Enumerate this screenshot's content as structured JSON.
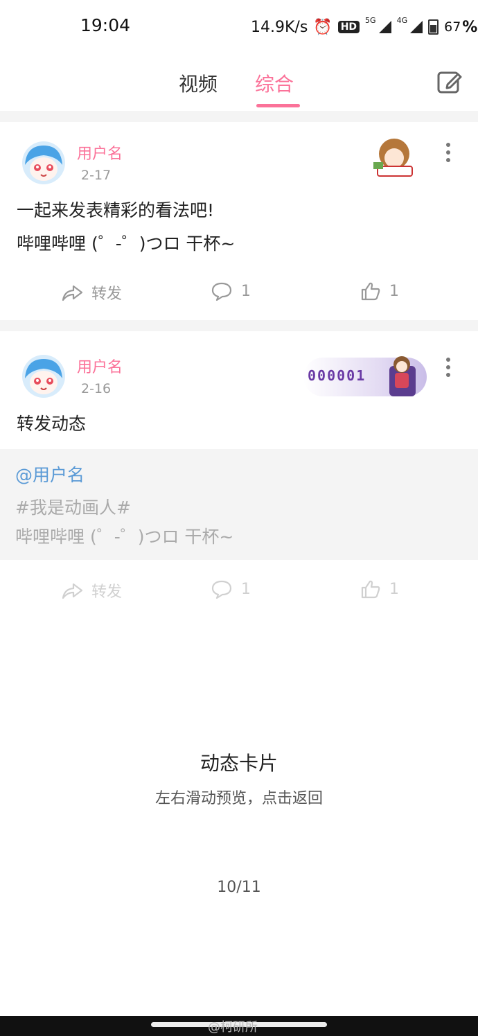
{
  "status_bar": {
    "time": "19:04",
    "net_speed": "14.9K/s",
    "hd_badge": "HD",
    "net_5g": "5G",
    "net_4g": "4G",
    "battery": "67",
    "battery_unit": "%"
  },
  "nav": {
    "tab_video": "视频",
    "tab_all": "综合",
    "active_tab": "综合",
    "accent_color": "#fb7299"
  },
  "posts": [
    {
      "username": "用户名",
      "date": "2-17",
      "line1": "一起来发表精彩的看法吧!",
      "line2": "哔哩哔哩 (゜-゜)つロ 干杯~",
      "repost_label": "转发",
      "comment_count": "1",
      "like_count": "1"
    },
    {
      "username": "用户名",
      "date": "2-16",
      "badge_text": "000001",
      "text": "转发动态",
      "quote_user": "@用户名",
      "quote_line1": "#我是动画人#",
      "quote_line2": "哔哩哔哩 (゜-゜)つロ 干杯~",
      "repost_label": "转发",
      "comment_count": "1",
      "like_count": "1"
    }
  ],
  "footer": {
    "title": "动态卡片",
    "subtitle": "左右滑动预览，点击返回",
    "page_indicator": "10/11"
  },
  "watermark": "@柯研所"
}
